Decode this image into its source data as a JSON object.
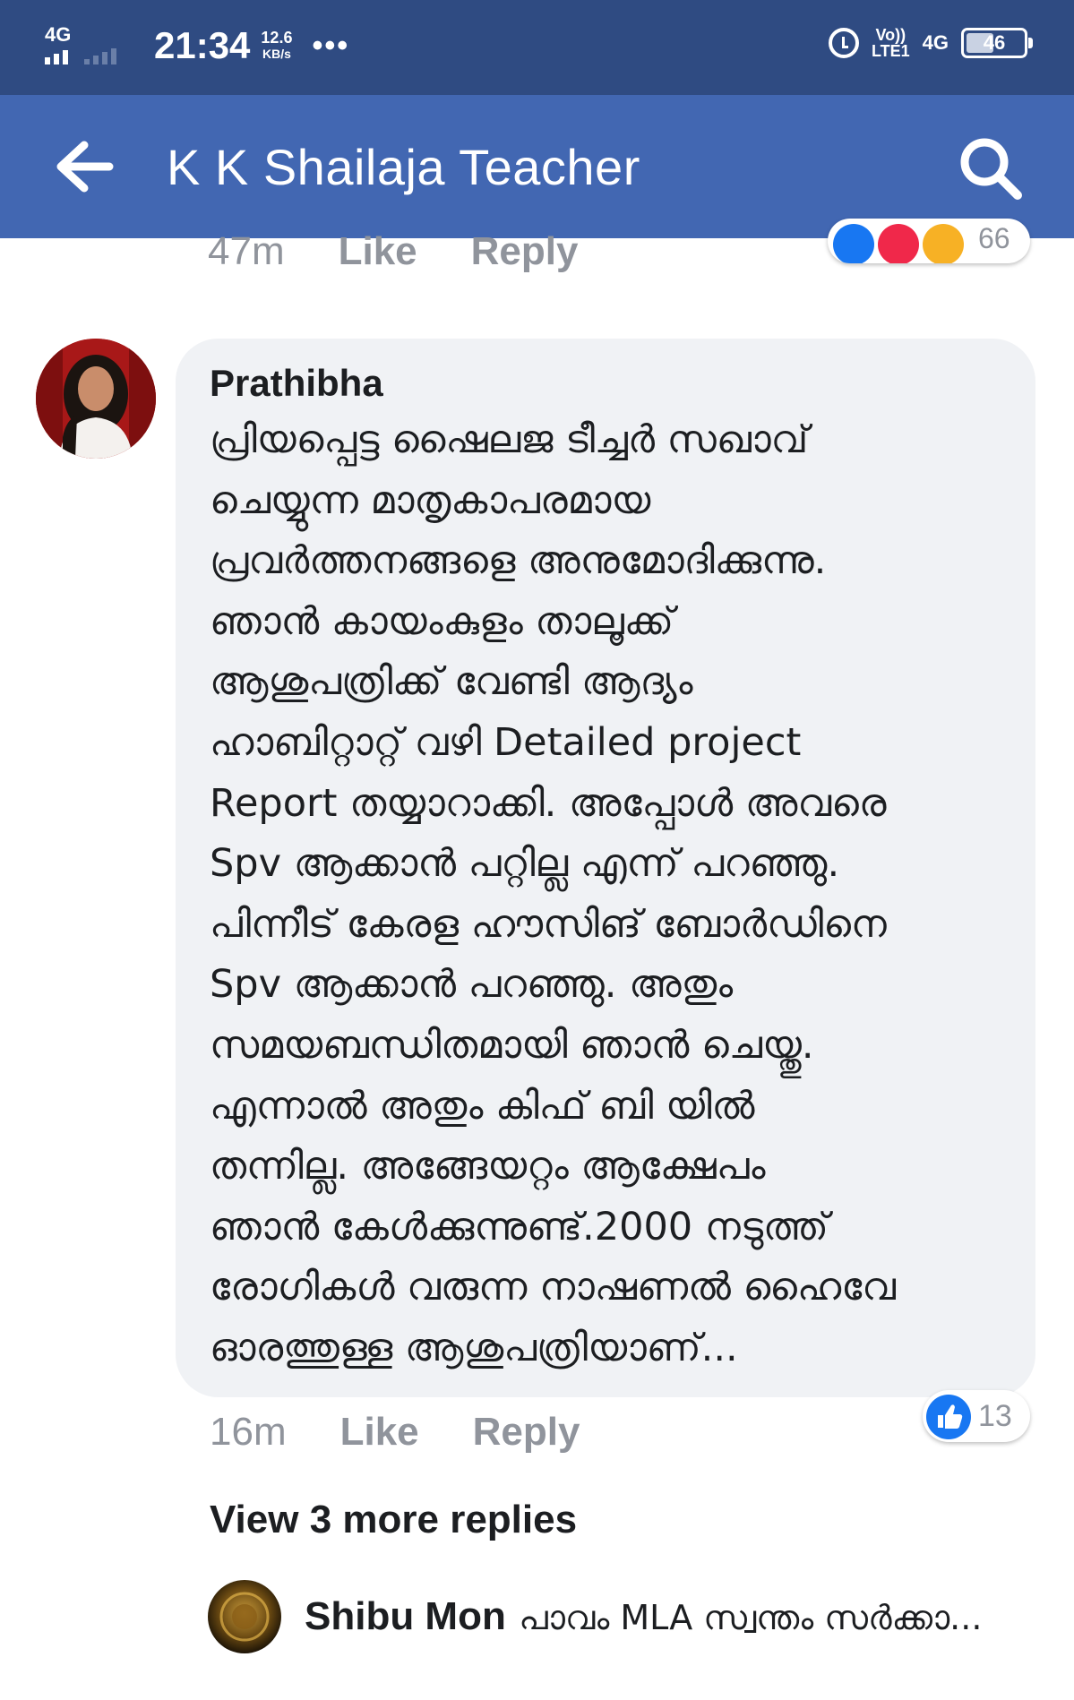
{
  "status_bar": {
    "network_left": "4G",
    "time": "21:34",
    "speed_value": "12.6",
    "speed_unit": "KB/s",
    "more": "•••",
    "volte": "Vo))",
    "lte": "LTE1",
    "network_right": "4G",
    "battery": "46"
  },
  "app_bar": {
    "title": "K K Shailaja Teacher",
    "back_icon": "back-arrow-icon",
    "search_icon": "search-icon"
  },
  "previous_comment": {
    "time": "47m",
    "like_label": "Like",
    "reply_label": "Reply",
    "reaction_count": "66"
  },
  "comment": {
    "author": "Prathibha",
    "lines": [
      "പ്രിയപ്പെട്ട ഷൈലജ ടീച്ചർ സഖാവ്",
      "ചെയ്യുന്ന മാതൃകാപരമായ",
      "പ്രവർത്തനങ്ങളെ അനുമോദിക്കുന്നു.",
      "ഞാൻ കായംകുളം താലൂക്ക്",
      "ആശുപത്രിക്ക് വേണ്ടി ആദ്യം",
      "ഹാബിറ്റാറ്റ് വഴി Detailed project",
      "Report തയ്യാറാക്കി. അപ്പോൾ അവരെ",
      "Spv ആക്കാൻ പറ്റില്ല എന്ന് പറഞ്ഞു.",
      "പിന്നീട് കേരള ഹൗസിങ് ബോർഡിനെ",
      "Spv ആക്കാൻ പറഞ്ഞു. അതും",
      "സമയബന്ധിതമായി ഞാൻ ചെയ്തു.",
      "എന്നാൽ അതും കിഫ് ബി യിൽ",
      "തന്നില്ല. അങ്ങേയറ്റം ആക്ഷേപം",
      "ഞാൻ കേൾക്കുന്നുണ്ട്.2000 നടുത്ത്",
      "രോഗികൾ വരുന്ന നാഷണൽ ഹൈവേ",
      "ഓരത്തുള്ള ആശുപത്രിയാണ്..."
    ],
    "time": "16m",
    "like_label": "Like",
    "reply_label": "Reply",
    "like_count": "13",
    "like_icon": "thumbs-up-icon"
  },
  "replies": {
    "view_more": "View 3 more replies",
    "latest": {
      "author": "Shibu Mon",
      "snippet": "പാവം MLA സ്വന്തം സർക്കാ..."
    }
  },
  "colors": {
    "status_bar": "#2f4b82",
    "app_bar": "#4267b2",
    "bubble": "#f0f2f5",
    "meta_text": "#90949c",
    "like_blue": "#1877f2"
  }
}
